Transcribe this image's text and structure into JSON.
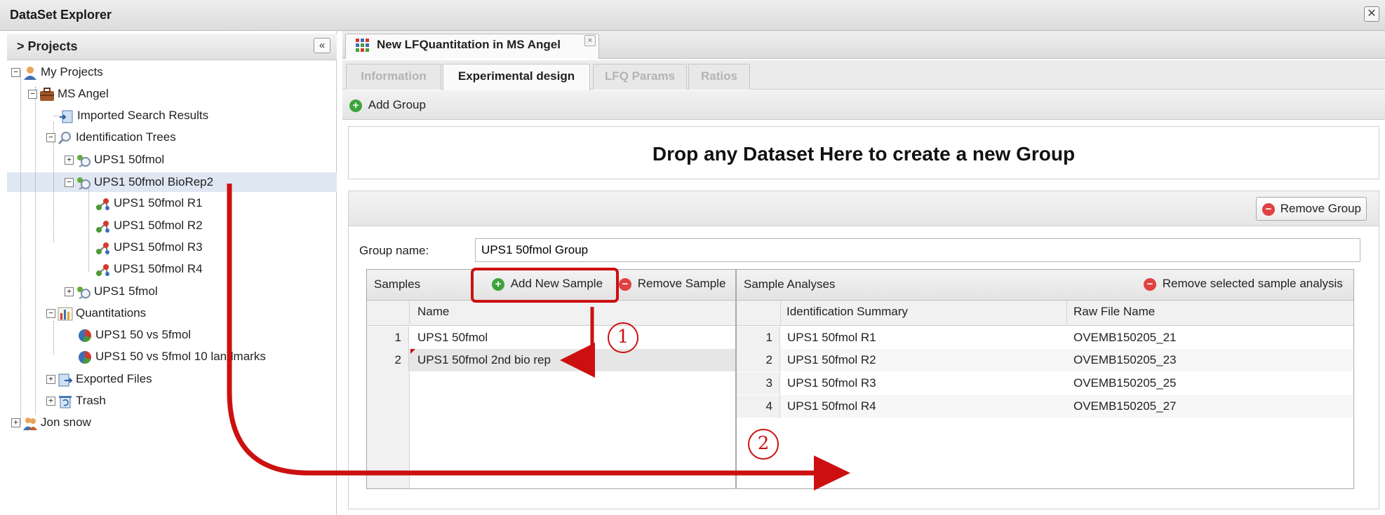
{
  "window": {
    "title": "DataSet Explorer",
    "close_glyph": "✕"
  },
  "left_panel": {
    "header_title": "> Projects",
    "collapse_glyph": "«",
    "tree": [
      {
        "label": "My Projects",
        "icon": "user-icon",
        "toggle": "−"
      },
      {
        "label": "MS Angel",
        "icon": "briefcase-icon",
        "toggle": "−"
      },
      {
        "label": "Imported Search Results",
        "icon": "imported-results-icon",
        "toggle": ""
      },
      {
        "label": "Identification Trees",
        "icon": "magnifier-icon",
        "toggle": "−"
      },
      {
        "label": "UPS1 50fmol",
        "icon": "identification-folder-icon",
        "toggle": "+"
      },
      {
        "label": "UPS1 50fmol BioRep2",
        "icon": "identification-folder-icon",
        "toggle": "−"
      },
      {
        "label": "UPS1 50fmol R1",
        "icon": "molecule-icon",
        "toggle": ""
      },
      {
        "label": "UPS1 50fmol R2",
        "icon": "molecule-icon",
        "toggle": ""
      },
      {
        "label": "UPS1 50fmol R3",
        "icon": "molecule-icon",
        "toggle": ""
      },
      {
        "label": "UPS1 50fmol R4",
        "icon": "molecule-icon",
        "toggle": ""
      },
      {
        "label": "UPS1 5fmol",
        "icon": "identification-folder-icon",
        "toggle": "+"
      },
      {
        "label": "Quantitations",
        "icon": "bar-chart-icon",
        "toggle": "−"
      },
      {
        "label": "UPS1 50 vs 5fmol",
        "icon": "pie-chart-icon",
        "toggle": ""
      },
      {
        "label": "UPS1 50 vs 5fmol 10 landmarks",
        "icon": "pie-chart-icon",
        "toggle": ""
      },
      {
        "label": "Exported Files",
        "icon": "export-icon",
        "toggle": "+"
      },
      {
        "label": "Trash",
        "icon": "trash-icon",
        "toggle": "+"
      },
      {
        "label": "Jon snow",
        "icon": "user-group-icon",
        "toggle": "+"
      }
    ]
  },
  "main": {
    "doc_tab": {
      "label": "New LFQuantitation in MS Angel",
      "icon": "grid-icon",
      "close_glyph": "×"
    },
    "subtabs": [
      {
        "label": "Information",
        "active": false
      },
      {
        "label": "Experimental design",
        "active": true
      },
      {
        "label": "LFQ Params",
        "active": false
      },
      {
        "label": "Ratios",
        "active": false
      }
    ],
    "toolbar": {
      "add_group_label": "Add Group"
    },
    "drop_zone_text": "Drop any Dataset Here to create a new Group",
    "group": {
      "remove_group_label": "Remove Group",
      "name_label": "Group name:",
      "name_value": "UPS1 50fmol Group"
    },
    "samples": {
      "title": "Samples",
      "add_label": "Add New Sample",
      "remove_label": "Remove Sample",
      "column_name": "Name",
      "rows": [
        {
          "num": "1",
          "name": "UPS1 50fmol"
        },
        {
          "num": "2",
          "name": "UPS1 50fmol 2nd bio rep"
        }
      ]
    },
    "analyses": {
      "title": "Sample Analyses",
      "remove_label": "Remove selected sample analysis",
      "columns": [
        "Identification Summary",
        "Raw File Name"
      ],
      "rows": [
        {
          "num": "1",
          "ident": "UPS1 50fmol R1",
          "raw": "OVEMB150205_21"
        },
        {
          "num": "2",
          "ident": "UPS1 50fmol R2",
          "raw": "OVEMB150205_23"
        },
        {
          "num": "3",
          "ident": "UPS1 50fmol R3",
          "raw": "OVEMB150205_25"
        },
        {
          "num": "4",
          "ident": "UPS1 50fmol R4",
          "raw": "OVEMB150205_27"
        }
      ]
    }
  },
  "annotations": {
    "step1_label": "1",
    "step2_label": "2",
    "color": "#cc1010"
  },
  "colors": {
    "selection": "#dfe7f2",
    "add_green": "#3ea43e",
    "remove_red": "#e04141"
  }
}
